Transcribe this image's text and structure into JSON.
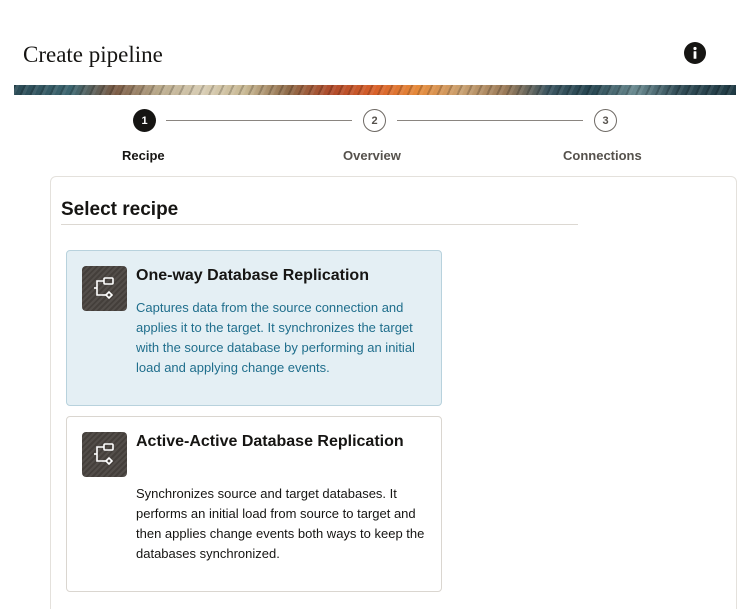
{
  "page": {
    "title": "Create pipeline"
  },
  "header": {
    "info_icon": "info-icon"
  },
  "steps": [
    {
      "number": "1",
      "label": "Recipe",
      "state": "active"
    },
    {
      "number": "2",
      "label": "Overview",
      "state": "inactive"
    },
    {
      "number": "3",
      "label": "Connections",
      "state": "inactive"
    }
  ],
  "section": {
    "heading": "Select recipe"
  },
  "recipes": [
    {
      "icon": "pipeline-flow-icon",
      "title": "One-way Database Replication",
      "description": "Captures data from the source connection and applies it to the target. It synchronizes the target with the source database by performing an initial load and applying change events.",
      "selected": true
    },
    {
      "icon": "pipeline-flow-icon",
      "title": "Active-Active Database Replication",
      "description": "Synchronizes source and target databases. It performs an initial load from source to target and then applies change events both ways to keep the databases synchronized.",
      "selected": false
    }
  ],
  "colors": {
    "selected_card_bg": "#e4eff4",
    "selected_text": "#1f6e8c",
    "active_step": "#161513"
  }
}
